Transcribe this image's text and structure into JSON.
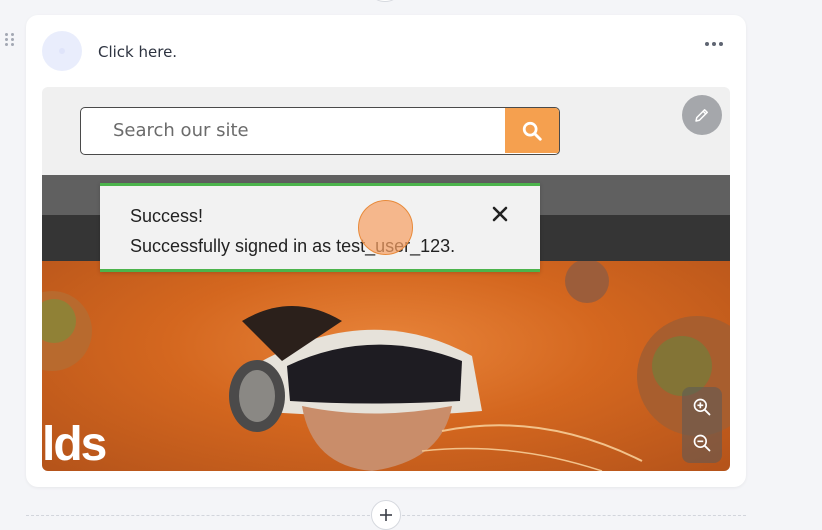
{
  "card": {
    "title": "Click here."
  },
  "search": {
    "placeholder": "Search our site"
  },
  "hero": {
    "text_fragment": "lds"
  },
  "toast": {
    "title": "Success!",
    "message": "Successfully signed in as test_user_123.",
    "close_label": "✖"
  },
  "icons": {
    "drag": "drag-handle-icon",
    "more": "more-horizontal-icon",
    "search": "search-icon",
    "edit": "pencil-icon",
    "zoom_in": "zoom-in-icon",
    "zoom_out": "zoom-out-icon",
    "close": "close-icon",
    "add": "plus-icon"
  },
  "colors": {
    "search_button": "#f5a04f",
    "toast_accent": "#4cb44c",
    "hero_bg": "#d4671f",
    "click_marker": "#f5a064"
  }
}
